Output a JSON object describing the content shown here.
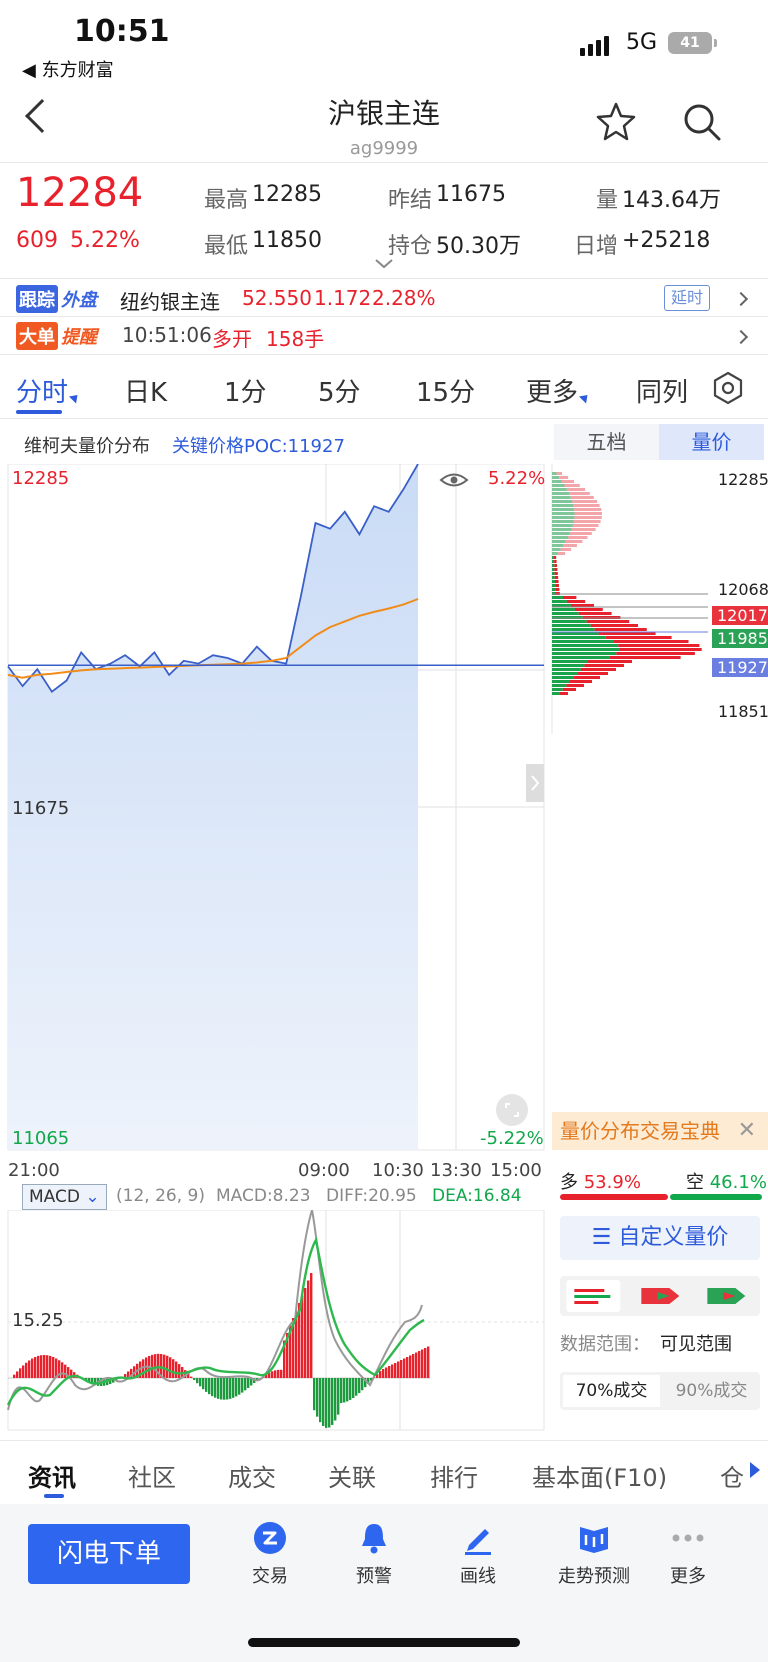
{
  "status_bar": {
    "time": "10:51",
    "back_app": "◀ 东方财富",
    "network": "5G",
    "battery": "41"
  },
  "header": {
    "title": "沪银主连",
    "code": "ag9999"
  },
  "quote": {
    "price": "12284",
    "change": "609",
    "change_pct": "5.22%",
    "high_label": "最高",
    "high": "12285",
    "low_label": "最低",
    "low": "11850",
    "prev_settle_label": "昨结",
    "prev_settle": "11675",
    "open_interest_label": "持仓",
    "open_interest": "50.30万",
    "volume_label": "量",
    "volume": "143.64万",
    "daily_inc_label": "日增",
    "daily_inc": "+25218"
  },
  "track_row": {
    "tag1": "跟踪",
    "tag2": "外盘",
    "name": "纽约银主连",
    "price": "52.550",
    "change": "1.172",
    "pct": "2.28%",
    "delay": "延时"
  },
  "bigorder_row": {
    "tag1": "大单",
    "tag2": "提醒",
    "time": "10:51:06",
    "action": "多开",
    "qty": "158手"
  },
  "tabs": [
    "分时",
    "日K",
    "1分",
    "5分",
    "15分",
    "更多",
    "同列"
  ],
  "chart_header": {
    "vwap_label": "维柯夫量价分布",
    "poc_label": "关键价格POC:11927"
  },
  "side_tabs": {
    "tab1": "五档",
    "tab2": "量价"
  },
  "chart_labels": {
    "y_top": "12285",
    "y_mid": "11675",
    "y_bot": "11065",
    "pct_top": "5.22%",
    "pct_bot": "-5.22%",
    "x_ticks": [
      "21:00",
      "09:00",
      "10:30",
      "13:30",
      "15:00"
    ]
  },
  "profile_labels": {
    "top": "12285",
    "p1": "12068",
    "p2": "12017",
    "p3": "11985",
    "p4": "11927",
    "bot": "11851"
  },
  "macd": {
    "name": "MACD",
    "params": "(12, 26, 9)",
    "macd": "MACD:8.23",
    "diff": "DIFF:20.95",
    "dea": "DEA:16.84",
    "level": "15.25"
  },
  "promo": {
    "title": "量价分布交易宝典",
    "long_label": "多",
    "long_pct": "53.9%",
    "short_label": "空",
    "short_pct": "46.1%",
    "custom_btn": "自定义量价",
    "range_label": "数据范围：",
    "range_value": "可见范围",
    "opt70": "70%成交",
    "opt90": "90%成交"
  },
  "bottom_tabs": [
    "资讯",
    "社区",
    "成交",
    "关联",
    "排行",
    "基本面(F10)",
    "仓"
  ],
  "toolbar": {
    "flash": "闪电下单",
    "trade": "交易",
    "alert": "预警",
    "draw": "画线",
    "forecast": "走势预测",
    "more": "更多"
  },
  "chart_data": {
    "type": "line",
    "title": "",
    "x": [
      "21:00",
      "09:00",
      "10:30",
      "13:30",
      "15:00"
    ],
    "ylim": [
      11065,
      12285
    ],
    "series": [
      {
        "name": "",
        "color": "#3a5fc8",
        "values": [
          11925,
          11890,
          11920,
          11880,
          11900,
          11950,
          11920,
          11930,
          11945,
          11925,
          11950,
          11910,
          11935,
          11930,
          11945,
          11940,
          11930,
          11960,
          11935,
          11930,
          12050,
          12180,
          12170,
          12200,
          12160,
          12210,
          12200,
          12240,
          12285
        ]
      },
      {
        "name": "",
        "color": "#f08c1a",
        "values": [
          11910,
          11905,
          11910,
          11912,
          11915,
          11918,
          11920,
          11921,
          11922,
          11923,
          11924,
          11925,
          11926,
          11927,
          11928,
          11929,
          11930,
          11932,
          11935,
          11940,
          11960,
          11980,
          11995,
          12005,
          12015,
          12022,
          12028,
          12035,
          12045
        ]
      }
    ],
    "poc": 11927
  }
}
